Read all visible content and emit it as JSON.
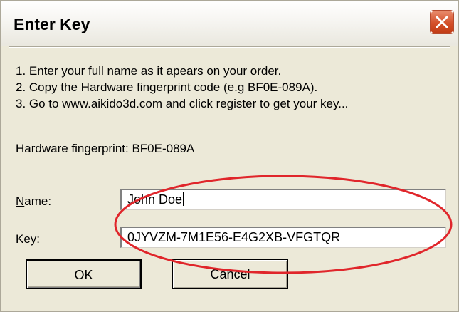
{
  "window": {
    "title": "Enter Key",
    "close_icon": "close-x-icon"
  },
  "instructions": [
    "1. Enter your full name as it apears on your order.",
    "2. Copy the Hardware fingerprint code (e.g BF0E-089A).",
    "3. Go to www.aikido3d.com and click register to get your key..."
  ],
  "fingerprint_text": "Hardware fingerprint: BF0E-089A",
  "form": {
    "name_label_mnemonic": "N",
    "name_label_rest": "ame:",
    "name_value": "John Doe",
    "key_label_mnemonic": "K",
    "key_label_rest": "ey:",
    "key_value": "0JYVZM-7M1E56-E4G2XB-VFGTQR"
  },
  "buttons": {
    "ok_label": "OK",
    "cancel_label": "Cancel"
  },
  "colors": {
    "dialog_face": "#ece9d8",
    "close_button": "#d4502a",
    "annotation_ellipse": "#e0262b"
  }
}
